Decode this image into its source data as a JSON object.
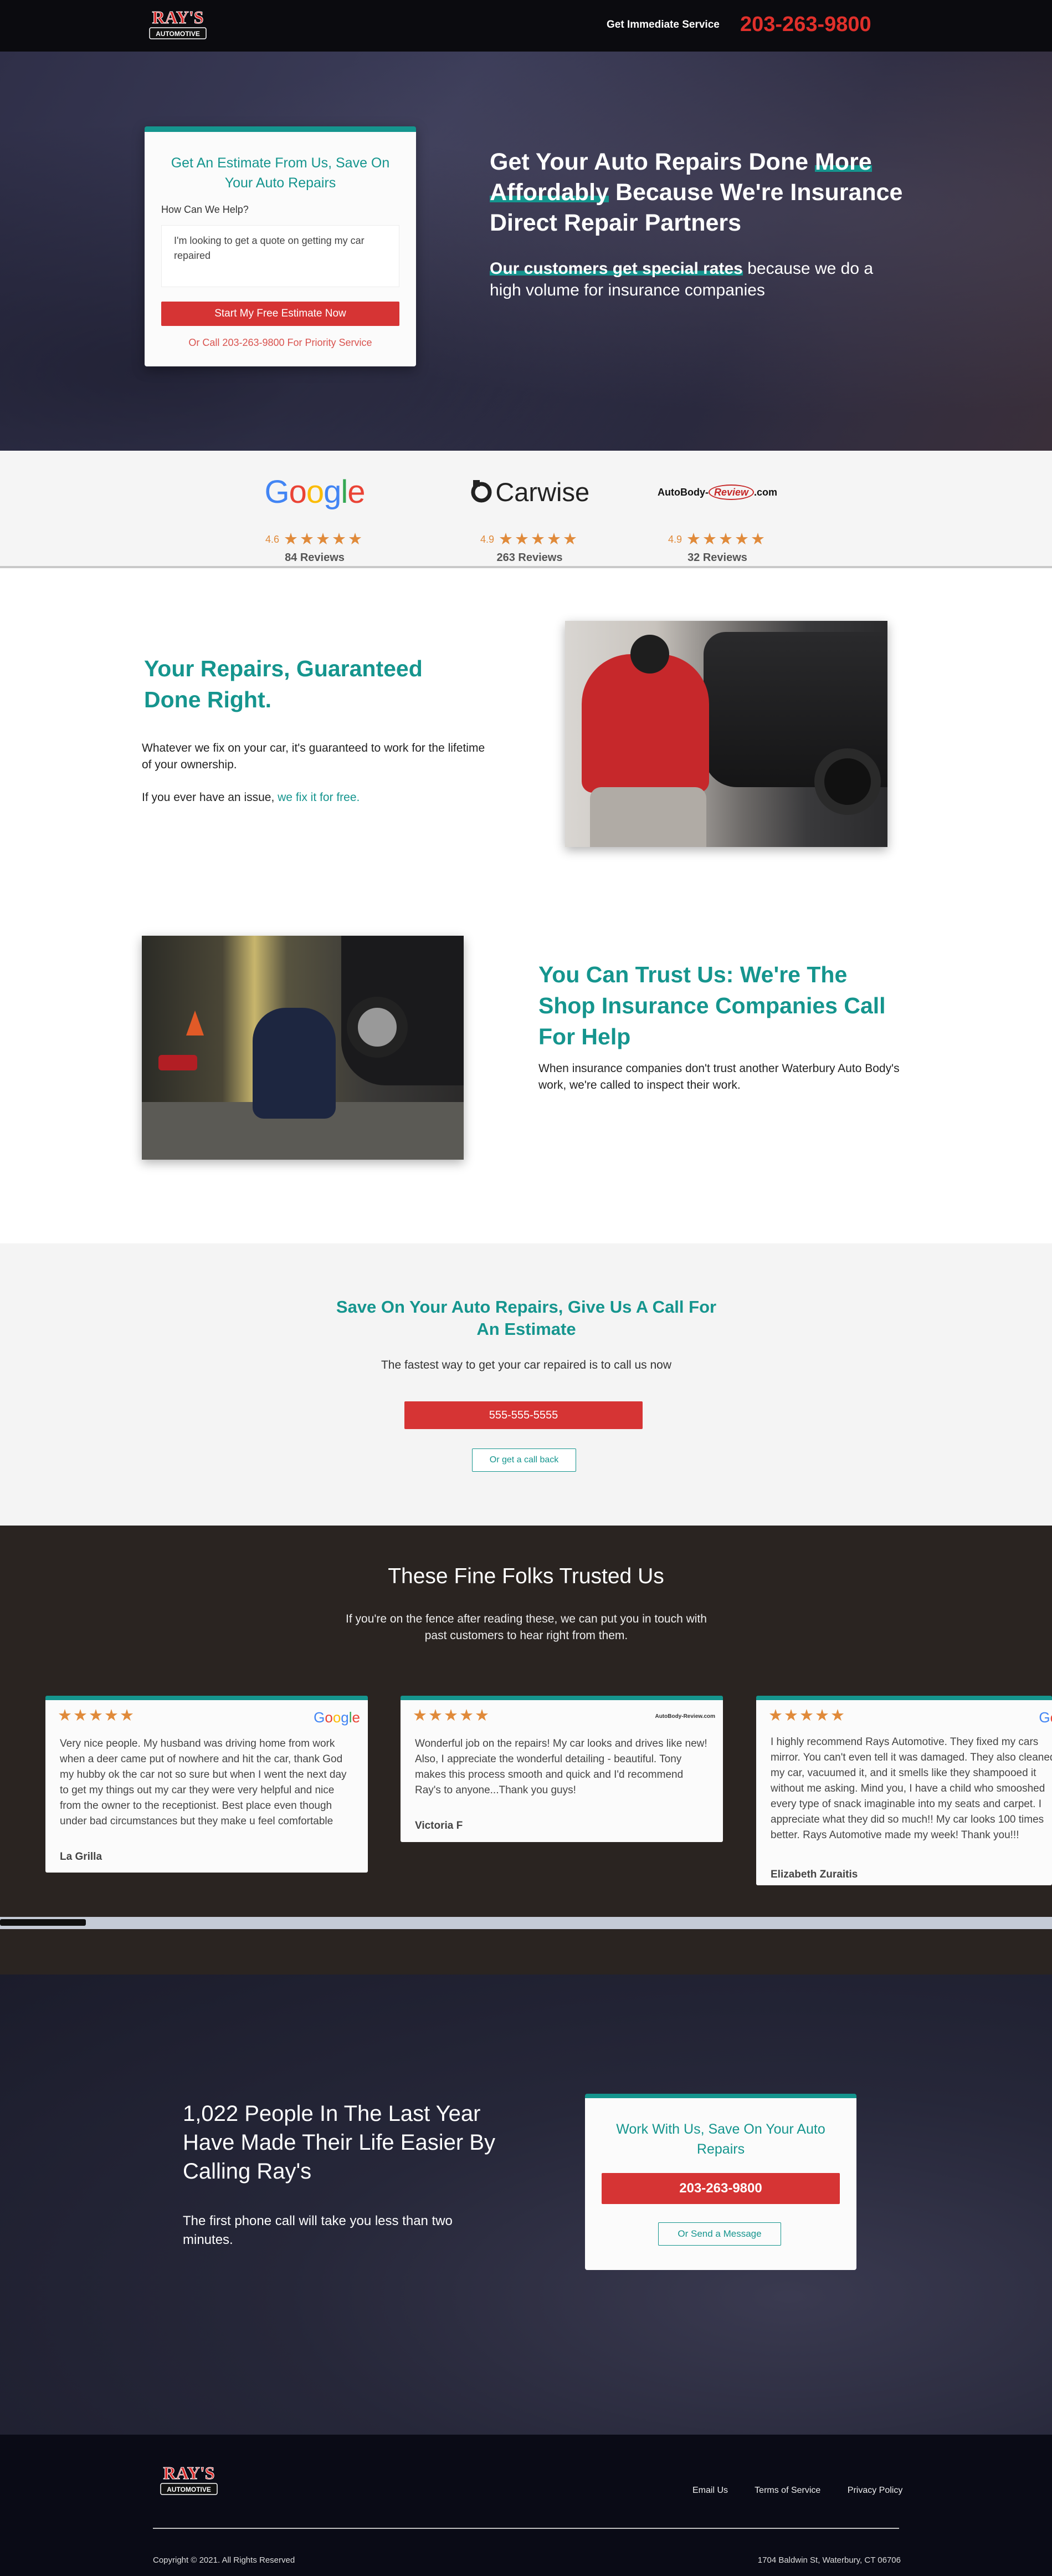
{
  "header": {
    "logo_line1": "RAY'S",
    "logo_line2": "AUTOMOTIVE",
    "cta_label": "Get Immediate Service",
    "cta_phone": "203-263-9800"
  },
  "hero": {
    "form": {
      "title": "Get An Estimate From Us, Save On Your Auto Repairs",
      "question_label": "How Can We Help?",
      "message_value": "I'm looking to get a quote on getting my car repaired",
      "submit_label": "Start My Free Estimate Now",
      "alt_call": "Or Call 203-263-9800 For Priority Service"
    },
    "headline_a": "Get Your Auto Repairs Done ",
    "headline_hl": "More Affordably",
    "headline_b": " Because We're Insurance Direct Repair Partners",
    "sub_hl": "Our customers get special rates",
    "sub_rest": " because we do a high volume for insurance companies"
  },
  "reviews": [
    {
      "brand": "Google",
      "score": "4.6",
      "stars": "★★★★★",
      "count": "84 Reviews"
    },
    {
      "brand": "Carwise",
      "score": "4.9",
      "stars": "★★★★★",
      "count": "263 Reviews"
    },
    {
      "brand_a": "AutoBody-",
      "brand_b": "Review",
      "brand_c": ".com",
      "score": "4.9",
      "stars": "★★★★★",
      "count": "32 Reviews"
    }
  ],
  "guarantee": {
    "title": "Your Repairs, Guaranteed Done Right.",
    "p1": "Whatever we fix on your car, it's guaranteed to work for the lifetime of your ownership.",
    "p2_text": "If you ever have an issue, ",
    "p2_link": "we fix it for free."
  },
  "trust": {
    "title": "You Can Trust Us: We're The Shop Insurance Companies Call For Help",
    "p": "When insurance companies don't trust another Waterbury Auto Body's work, we're called to inspect their work."
  },
  "callband": {
    "title": "Save On Your Auto Repairs, Give Us A Call For An Estimate",
    "sub": "The fastest way to get your car repaired is to call us now",
    "phone_btn": "555-555-5555",
    "callback_btn": "Or get a call back"
  },
  "testimonials": {
    "title": "These Fine Folks Trusted Us",
    "sub": "If you're on the fence after reading these, we can put you in touch with past customers to hear right from them.",
    "items": [
      {
        "stars": "★★★★★",
        "source": "Google",
        "body": "Very nice people. My husband was driving home from work when a deer came put of nowhere and hit the car, thank God my hubby ok the car not so sure but when I went the next day to get my things out my car they were very helpful and nice from the owner to the receptionist.  Best place even though under bad circumstances but they make u feel comfortable",
        "author": "La Grilla"
      },
      {
        "stars": "★★★★★",
        "source": "AutoBody-Review.com",
        "body": "Wonderful job on the repairs! My car looks and drives like new! Also, I appreciate the wonderful detailing - beautiful. Tony makes this process smooth and quick and I'd recommend Ray's to anyone...Thank you guys!",
        "author": "Victoria F"
      },
      {
        "stars": "★★★★★",
        "source": "Google",
        "body": "I highly recommend Rays Automotive. They fixed my cars mirror. You can't even tell it was damaged. They also cleaned my car, vacuumed it, and it smells like they shampooed it without me asking. Mind you, I have a child who smooshed every type of snack imaginable into my seats and carpet. I appreciate what they did so much!! My car looks 100 times better. Rays Automotive made my week! Thank you!!!",
        "author": "Elizabeth Zuraitis"
      }
    ]
  },
  "cta2": {
    "title": "1,022 People In The Last Year Have Made Their Life Easier By Calling Ray's",
    "sub": "The first phone call will take you less than two minutes.",
    "card_title": "Work With Us, Save On Your Auto Repairs",
    "phone": "203-263-9800",
    "message_btn": "Or Send a Message"
  },
  "footer": {
    "links": [
      "Email Us",
      "Terms of Service",
      "Privacy Policy"
    ],
    "copyright": "Copyright © 2021. All Rights Reserved",
    "address": "1704 Baldwin St, Waterbury, CT 06706"
  },
  "colors": {
    "teal": "#15958e",
    "red": "#d63434",
    "star": "#e08a3a",
    "dark": "#0b0b0f"
  }
}
